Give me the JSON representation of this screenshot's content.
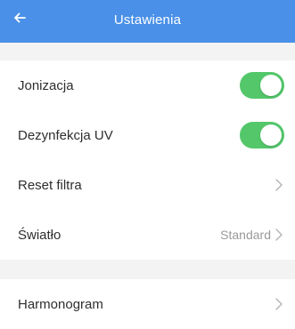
{
  "header": {
    "title": "Ustawienia",
    "back_icon": "arrow-left-icon",
    "background": "#4a90e8"
  },
  "settings": {
    "ionization": {
      "label": "Jonizacja",
      "enabled": true
    },
    "uv": {
      "label": "Dezynfekcja UV",
      "enabled": true
    },
    "filter_reset": {
      "label": "Reset filtra"
    },
    "light": {
      "label": "Światło",
      "value": "Standard"
    },
    "schedule": {
      "label": "Harmonogram"
    }
  },
  "colors": {
    "toggle_on": "#53c76a",
    "section_bg": "#f3f3f3",
    "chevron": "#b3b3b3"
  }
}
